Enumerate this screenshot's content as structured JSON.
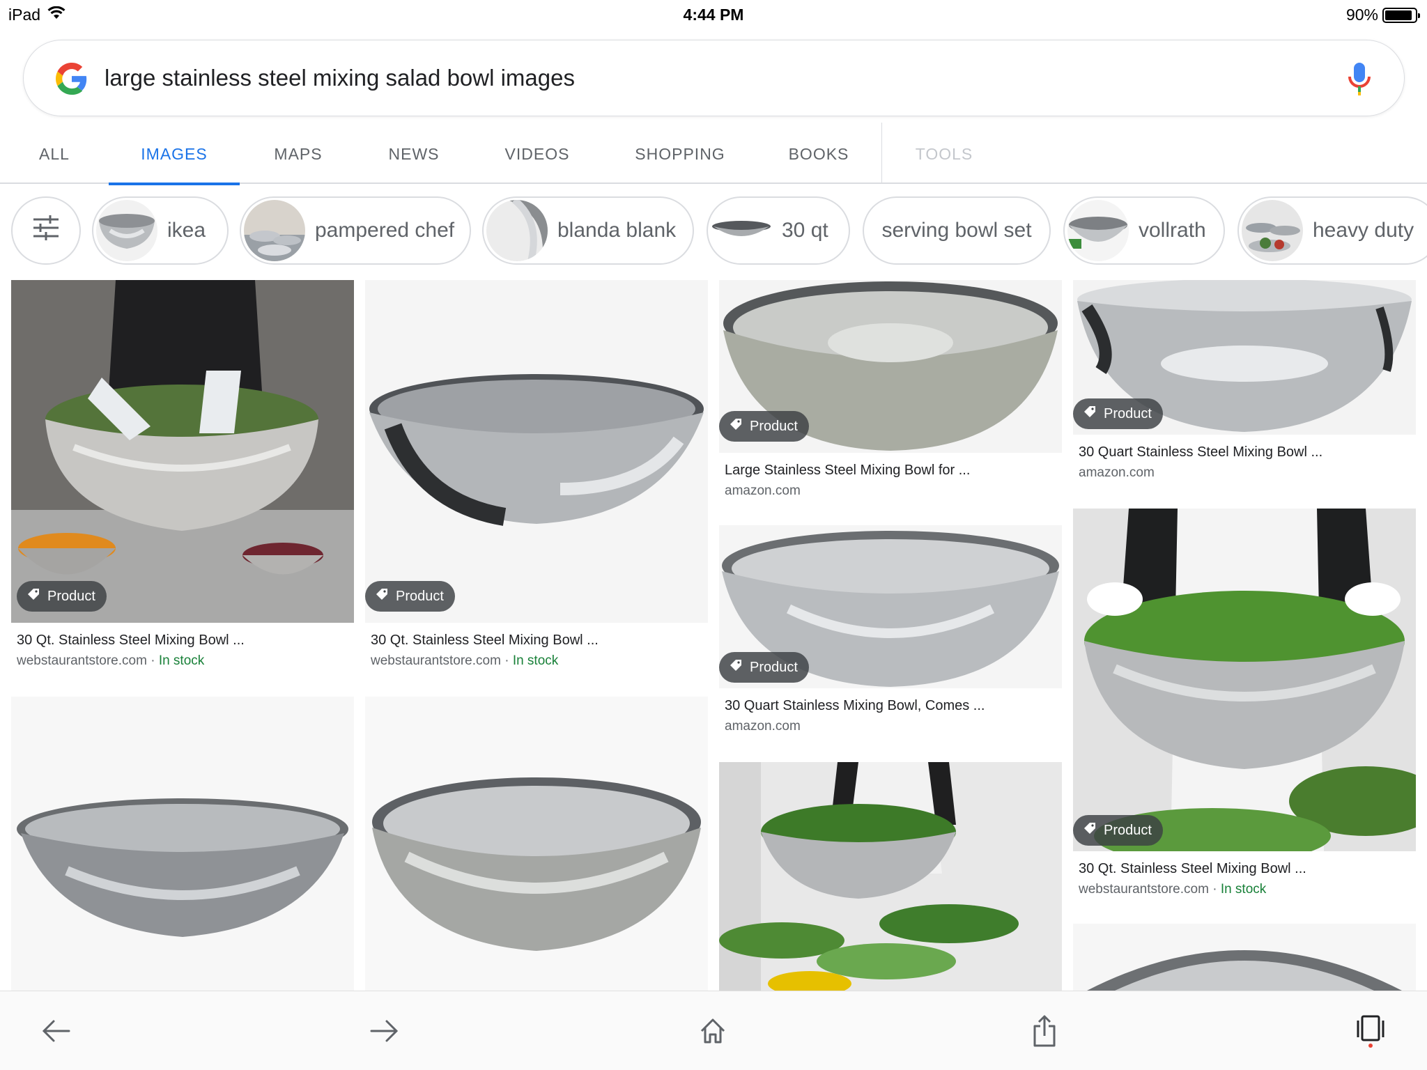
{
  "status_bar": {
    "device": "iPad",
    "time": "4:44 PM",
    "battery": "90%",
    "battery_level": 0.9
  },
  "search": {
    "query": "large stainless steel mixing salad bowl images",
    "logo_icon": "google-g-icon",
    "voice_icon": "mic-icon"
  },
  "tabs": [
    {
      "label": "ALL"
    },
    {
      "label": "IMAGES",
      "active": true
    },
    {
      "label": "MAPS"
    },
    {
      "label": "NEWS"
    },
    {
      "label": "VIDEOS"
    },
    {
      "label": "SHOPPING"
    },
    {
      "label": "BOOKS"
    },
    {
      "label": "TOOLS",
      "disabled": true
    }
  ],
  "chips": [
    {
      "label": "ikea"
    },
    {
      "label": "pampered chef"
    },
    {
      "label": "blanda blank"
    },
    {
      "label": "30 qt"
    },
    {
      "label": "serving bowl set"
    },
    {
      "label": "vollrath"
    },
    {
      "label": "heavy duty"
    }
  ],
  "results": [
    {
      "title": "30 Qt. Stainless Steel Mixing Bowl ...",
      "source": "webstaurantstore.com",
      "stock": "In stock",
      "badge": "Product"
    },
    {
      "title": "30 Qt. Stainless Steel Mixing Bowl ...",
      "source": "webstaurantstore.com",
      "stock": "In stock",
      "badge": "Product"
    },
    {
      "title": "Large Stainless Steel Mixing Bowl for ...",
      "source": "amazon.com",
      "badge": "Product"
    },
    {
      "title": "30 Quart Stainless Steel Mixing Bowl ...",
      "source": "amazon.com",
      "badge": "Product"
    },
    {
      "title": "30 Quart Stainless Mixing Bowl, Comes ...",
      "source": "amazon.com",
      "badge": "Product"
    },
    {
      "title": "30 Qt. Stainless Steel Mixing Bowl ...",
      "source": "webstaurantstore.com",
      "stock": "In stock",
      "badge": "Product"
    }
  ],
  "stock_separator": " · ",
  "colors": {
    "accent": "#1a73e8",
    "in_stock": "#188038",
    "badge_bg": "#3c4043"
  },
  "toolbar": {
    "icons": [
      "back-arrow-icon",
      "forward-arrow-icon",
      "home-icon",
      "share-icon",
      "tabs-icon"
    ]
  }
}
